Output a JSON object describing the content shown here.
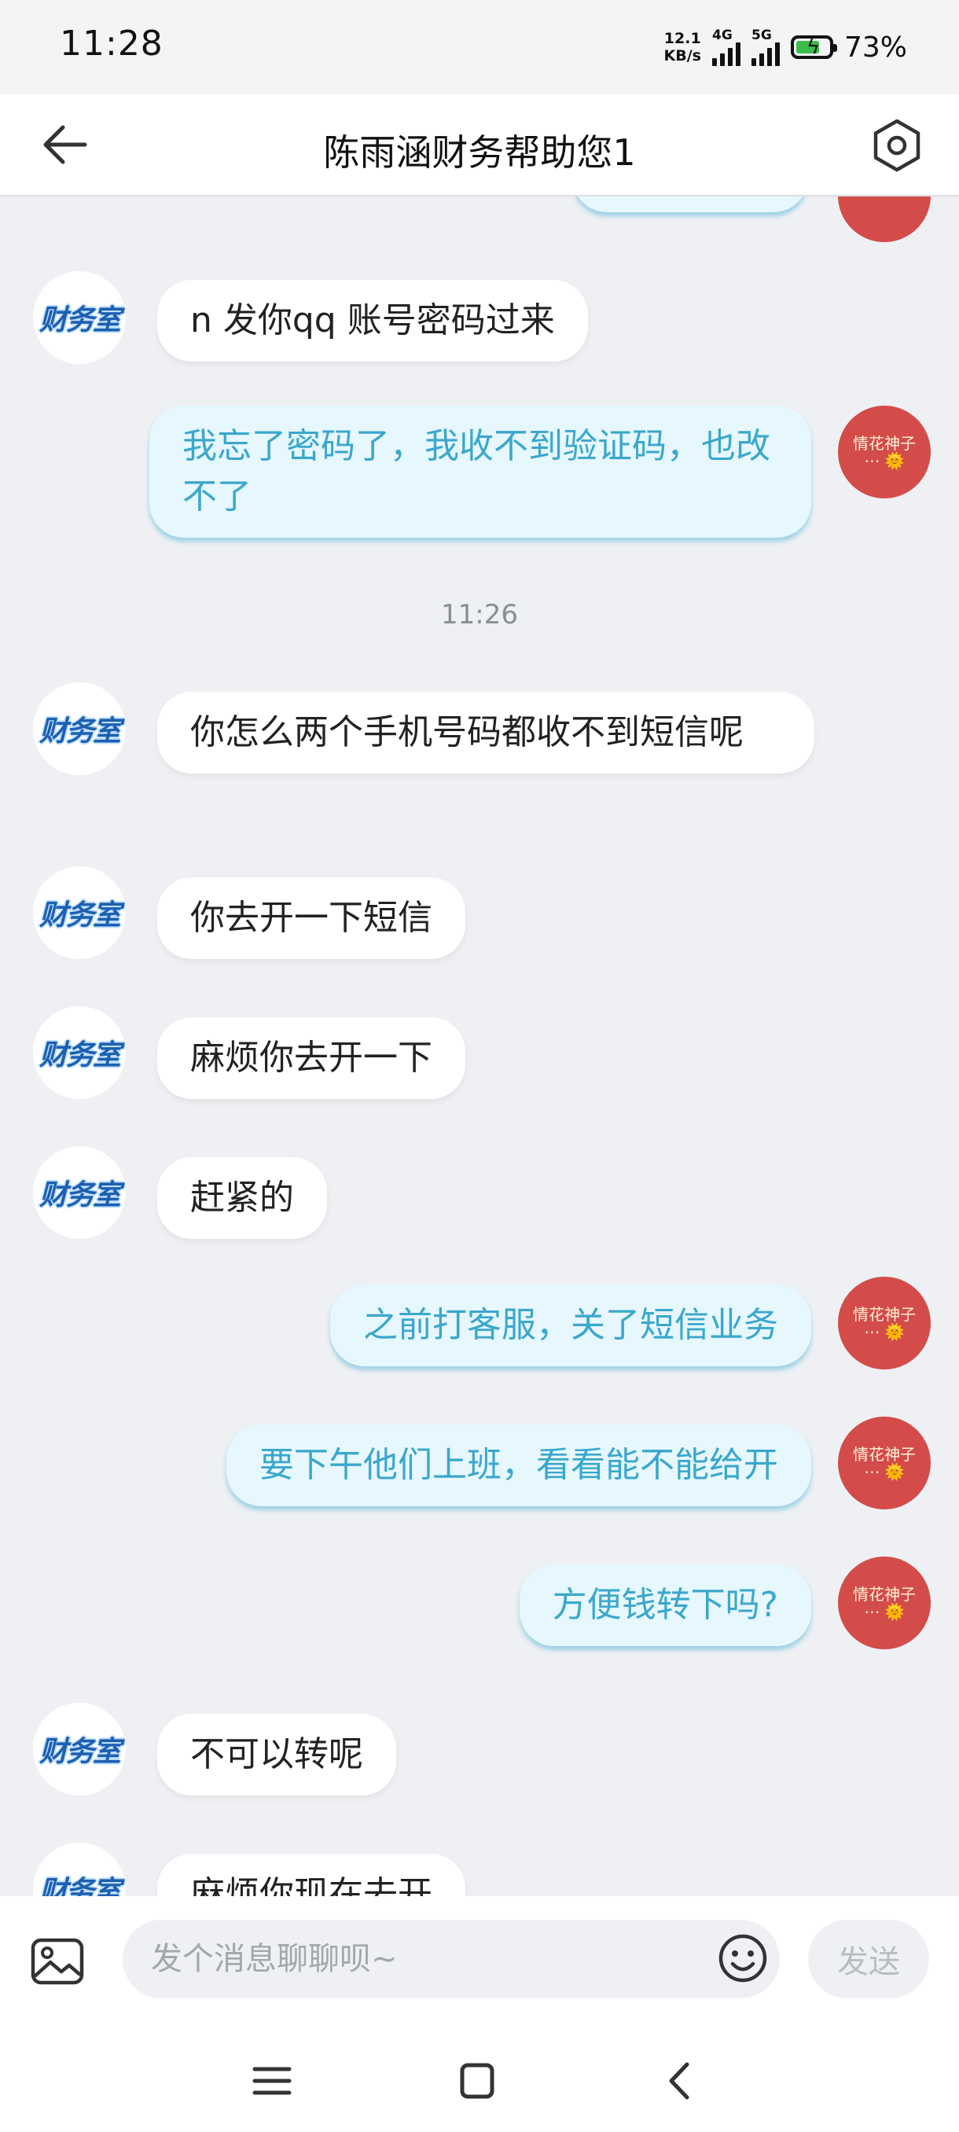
{
  "status_bar": {
    "time": "11:28",
    "net_speed_value": "12.1",
    "net_speed_unit": "KB/s",
    "signal_1_label": "4G",
    "signal_2_label": "5G",
    "battery_percent": "73%",
    "battery_level": 0.73
  },
  "header": {
    "title": "陈雨涵财务帮助您1",
    "back_icon": "arrow-left-icon",
    "settings_icon": "hexagon-gear-icon"
  },
  "avatars": {
    "contact_text": "财务室",
    "self_line1": "情花神子",
    "self_line2": "⋯ 🌞"
  },
  "messages": [
    {
      "side": "left",
      "text": "n 发你qq 账号密码过来"
    },
    {
      "side": "right",
      "text": "我忘了密码了，我收不到验证码，也改不了"
    },
    {
      "side": "time",
      "text": "11:26"
    },
    {
      "side": "left",
      "text": "你怎么两个手机号码都收不到短信呢"
    },
    {
      "side": "left",
      "text": "你去开一下短信"
    },
    {
      "side": "left",
      "text": "麻烦你去开一下"
    },
    {
      "side": "left",
      "text": "赶紧的"
    },
    {
      "side": "right",
      "text": "之前打客服，关了短信业务"
    },
    {
      "side": "right",
      "text": "要下午他们上班，看看能不能给开"
    },
    {
      "side": "right",
      "text": "方便钱转下吗?"
    },
    {
      "side": "left",
      "text": "不可以转呢"
    },
    {
      "side": "left",
      "text": "麻烦你现在去开"
    }
  ],
  "input_bar": {
    "placeholder": "发个消息聊聊呗~",
    "send_label": "发送",
    "image_icon": "image-icon",
    "emoji_icon": "emoji-icon"
  },
  "nav_bar": {
    "menu_icon": "menu-icon",
    "home_icon": "home-square-icon",
    "back_icon": "chevron-left-icon"
  },
  "colors": {
    "chat_background": "#eef0f3",
    "outgoing_bubble": "#e6f7fd",
    "outgoing_text": "#3aa7cc",
    "incoming_bubble": "#ffffff",
    "self_avatar": "#d34c4a"
  }
}
